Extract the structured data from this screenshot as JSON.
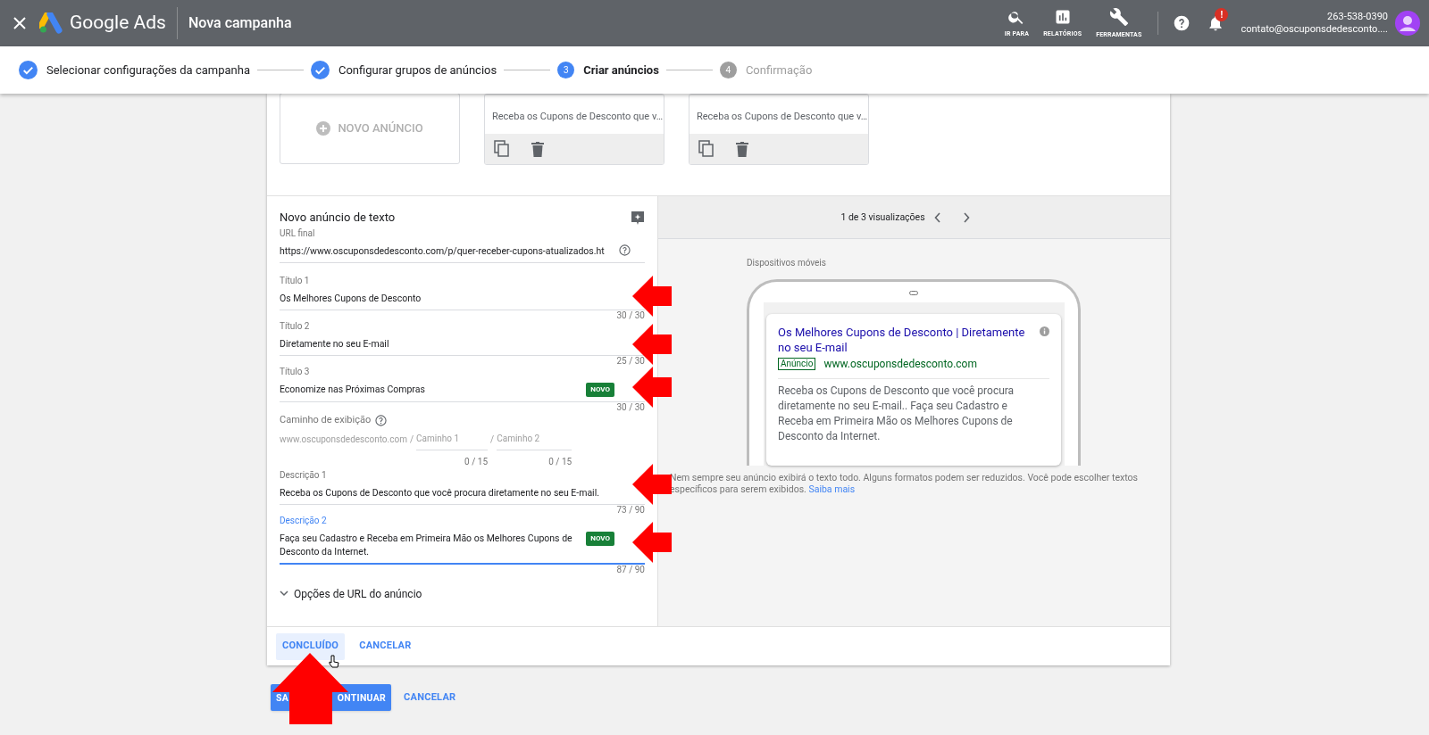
{
  "header": {
    "brand": "Google Ads",
    "title": "Nova campanha",
    "nav": [
      {
        "label": "IR PARA"
      },
      {
        "label": "RELATÓRIOS"
      },
      {
        "label": "FERRAMENTAS"
      }
    ],
    "notification_badge": "!",
    "account": {
      "phone": "263-538-0390",
      "email": "contato@oscuponsdedesconto...."
    }
  },
  "steps": [
    {
      "label": "Selecionar configurações da campanha",
      "completed": true,
      "selected": false
    },
    {
      "label": "Configurar grupos de anúncios",
      "completed": true,
      "selected": false
    },
    {
      "label": "Criar anúncios",
      "number": "3",
      "completed": false,
      "selected": true
    },
    {
      "label": "Confirmação",
      "number": "4",
      "completed": false,
      "selected": false
    }
  ],
  "ad_list": {
    "new_ad": "NOVO ANÚNCIO",
    "ads": [
      {
        "description": "Receba os Cupons de Desconto que v…"
      },
      {
        "description": "Receba os Cupons de Desconto que v…"
      }
    ]
  },
  "editor": {
    "title": "Novo anúncio de texto",
    "fields": [
      {
        "kind": "url",
        "label": "URL final",
        "value": "https://www.oscuponsdedesconto.com/p/quer-receber-cupons-atualizados.ht",
        "focused": false
      },
      {
        "kind": "text",
        "label": "Título 1",
        "value": "Os Melhores Cupons de Desconto",
        "counter": "30 / 30",
        "badge": false,
        "focused": false
      },
      {
        "kind": "text",
        "label": "Título 2",
        "value": "Diretamente no seu E-mail",
        "counter": "25 / 30",
        "badge": false,
        "focused": false
      },
      {
        "kind": "text",
        "label": "Título 3",
        "value": "Economize nas Próximas Compras",
        "counter": "30 / 30",
        "badge": "NOVO",
        "focused": false
      },
      {
        "kind": "path",
        "label": "Caminho de exibição",
        "domain": "www.oscuponsdedesconto.com",
        "separator": "/",
        "placeholder1": "Caminho 1",
        "placeholder2": "Caminho 2",
        "counter1": "0 / 15",
        "counter2": "0 / 15"
      },
      {
        "kind": "text",
        "label": "Descrição 1",
        "value": "Receba os Cupons de Desconto que você procura diretamente no seu E-mail.",
        "counter": "73 / 90",
        "badge": false,
        "focused": false
      },
      {
        "kind": "text",
        "label": "Descrição 2",
        "value": "Faça seu Cadastro e Receba em Primeira Mão os Melhores Cupons de Desconto da Internet.",
        "counter": "87 / 90",
        "badge": "NOVO",
        "focused": true
      }
    ],
    "url_options": {
      "label": "Opções de URL do anúncio",
      "expanded": false
    },
    "done_button": "CONCLUÍDO",
    "cancel_button": "CANCELAR"
  },
  "preview": {
    "pager": "1 de 3 visualizações",
    "device": "Dispositivos móveis",
    "ad": {
      "headline": "Os Melhores Cupons de Desconto | Diretamente no seu E-mail",
      "tag": "Anúncio",
      "url": "www.oscuponsdedesconto.com",
      "description": "Receba os Cupons de Desconto que você procura diretamente no seu E-mail.. Faça seu Cadastro e Receba em Primeira Mão os Melhores Cupons de Desconto da Internet."
    },
    "note": "Nem sempre seu anúncio exibirá o texto todo. Alguns formatos podem ser reduzidos. Você pode escolher textos específicos para serem exibidos.",
    "link": "Saiba mais"
  },
  "footer": {
    "save_button": [
      "SA",
      "ONTINUAR"
    ],
    "cancel_button": "CANCELAR"
  }
}
